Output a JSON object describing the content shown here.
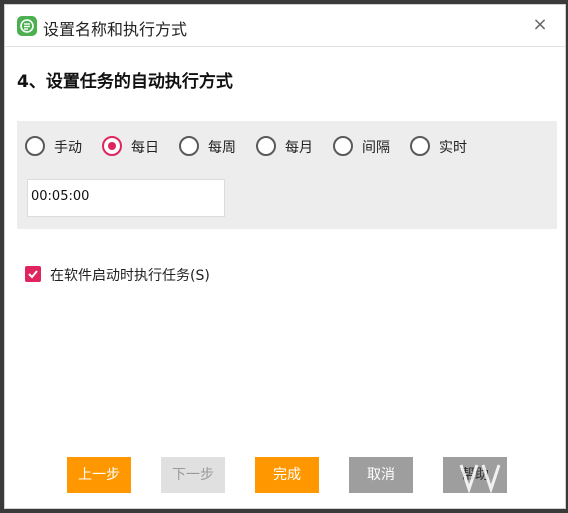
{
  "window": {
    "title": "设置名称和执行方式",
    "close_symbol": "×"
  },
  "step": {
    "heading": "4、设置任务的自动执行方式"
  },
  "schedule": {
    "options": [
      {
        "label": "手动",
        "checked": false
      },
      {
        "label": "每日",
        "checked": true
      },
      {
        "label": "每周",
        "checked": false
      },
      {
        "label": "每月",
        "checked": false
      },
      {
        "label": "间隔",
        "checked": false
      },
      {
        "label": "实时",
        "checked": false
      }
    ],
    "time_value": "00:05:00"
  },
  "startup": {
    "label": "在软件启动时执行任务(S)",
    "checked": true
  },
  "buttons": {
    "prev": "上一步",
    "next": "下一步",
    "finish": "完成",
    "cancel": "取消",
    "help": "帮助"
  },
  "colors": {
    "accent": "#e0245e",
    "primary_button": "#ff9800",
    "secondary_button": "#9e9e9e",
    "disabled_button": "#e0e0e0",
    "app_icon": "#4caf50"
  },
  "icons": {
    "app": "app-logo-icon",
    "close": "close-icon",
    "check": "checkmark-icon",
    "watermark": "watermark-logo"
  }
}
